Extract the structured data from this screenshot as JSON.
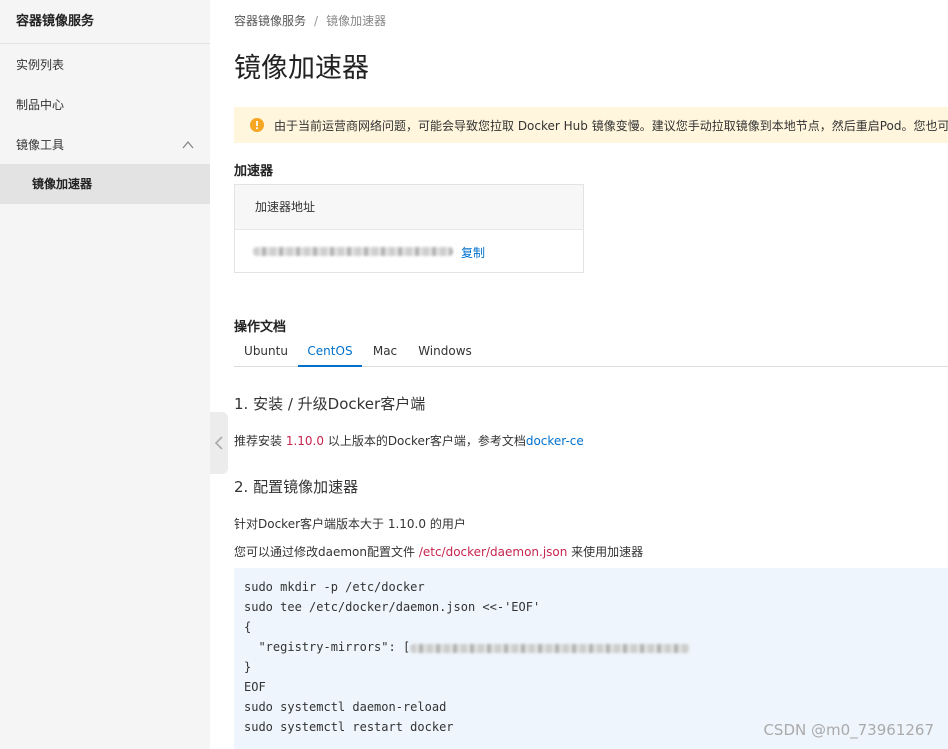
{
  "sidebar": {
    "brand": "容器镜像服务",
    "items": [
      {
        "label": "实例列表"
      },
      {
        "label": "制品中心"
      },
      {
        "label": "镜像工具"
      },
      {
        "label": "镜像加速器"
      }
    ]
  },
  "breadcrumb": {
    "root": "容器镜像服务",
    "sep": "/",
    "current": "镜像加速器"
  },
  "page_title": "镜像加速器",
  "notice": "由于当前运营商网络问题，可能会导致您拉取 Docker Hub 镜像变慢。建议您手动拉取镜像到本地节点，然后重启Pod。您也可以",
  "accelerator": {
    "section_title": "加速器",
    "column_header": "加速器地址",
    "copy_label": "复制"
  },
  "docs": {
    "section_title": "操作文档",
    "tabs": [
      {
        "label": "Ubuntu"
      },
      {
        "label": "CentOS"
      },
      {
        "label": "Mac"
      },
      {
        "label": "Windows"
      }
    ],
    "active_tab": "CentOS",
    "step1_title": "1. 安装 / 升级Docker客户端",
    "step1_prefix": "推荐安装 ",
    "step1_version": "1.10.0",
    "step1_mid": " 以上版本的Docker客户端，参考文档",
    "step1_link": "docker-ce",
    "step2_title": "2. 配置镜像加速器",
    "step2_line1": "针对Docker客户端版本大于 1.10.0 的用户",
    "step2_line2_prefix": "您可以通过修改daemon配置文件 ",
    "step2_line2_path": "/etc/docker/daemon.json",
    "step2_line2_suffix": " 来使用加速器",
    "code_lines": [
      "sudo mkdir -p /etc/docker",
      "sudo tee /etc/docker/daemon.json <<-'EOF'",
      "{",
      "  \"registry-mirrors\": [",
      "}",
      "EOF",
      "sudo systemctl daemon-reload",
      "sudo systemctl restart docker"
    ]
  },
  "watermark": "CSDN @m0_73961267",
  "colors": {
    "accent": "#0070cc",
    "notice_bg": "#fff6dd",
    "warn": "#f5a623",
    "code_bg": "#eef5fc",
    "sidebar_bg": "#f5f5f5"
  }
}
